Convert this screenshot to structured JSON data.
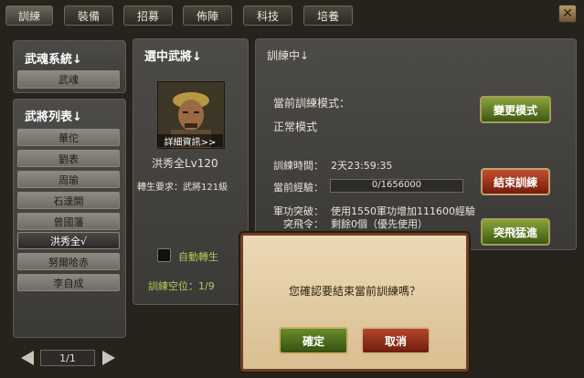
{
  "tabs": [
    "訓練",
    "裝備",
    "招募",
    "佈陣",
    "科技",
    "培養"
  ],
  "close_label": "✕",
  "soul_system": {
    "title": "武魂系統↓",
    "button": "武魂"
  },
  "general_list": {
    "title": "武將列表↓",
    "items": [
      "華佗",
      "劉表",
      "周瑜",
      "石達開",
      "曾國藩",
      "洪秀全√",
      "努爾哈赤",
      "李自成"
    ],
    "selected_index": 5,
    "pager": "1/1"
  },
  "selected_general": {
    "title": "選中武將↓",
    "details_label": "詳細資訊>>",
    "name_level": "洪秀全Lv120",
    "reincarnation_req": "轉生要求：武將121級",
    "auto_reincarnate_label": "自動轉生",
    "training_slots": "訓練空位：1/9"
  },
  "training": {
    "title": "訓練中↓",
    "mode_label": "當前訓練模式：",
    "mode_value": "正常模式",
    "change_mode_button": "變更模式",
    "time_label": "訓練時間：",
    "time_value": "2天23:59:35",
    "exp_label": "當前經驗：",
    "exp_value": "0/1656000",
    "exp_progress": 0,
    "end_button": "結束訓練",
    "breakthrough_label": "軍功突破：",
    "breakthrough_value": "使用1550軍功增加111600經驗",
    "leap_label": "突飛令：",
    "leap_value": "剩餘0個（優先使用）",
    "leap_button": "突飛猛進"
  },
  "dialog": {
    "message": "您確認要結束當前訓練嗎？",
    "confirm": "確定",
    "cancel": "取消"
  },
  "colors": {
    "accent_green": "#b7c95a",
    "confirm_green": "#4c6b1c",
    "cancel_red": "#8d2a14"
  }
}
